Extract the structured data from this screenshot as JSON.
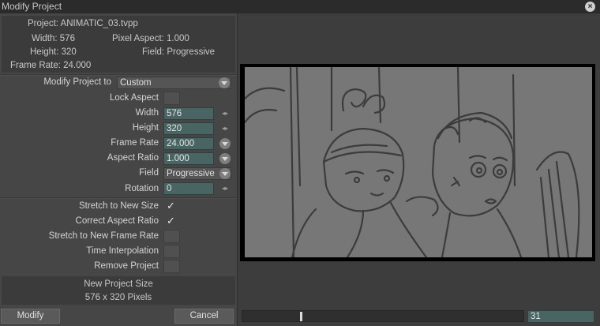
{
  "window": {
    "title": "Modify Project"
  },
  "project": {
    "name": "Project: ANIMATIC_03.tvpp",
    "width": "Width: 576",
    "pixel_aspect": "Pixel Aspect: 1.000",
    "height": "Height: 320",
    "field": "Field: Progressive",
    "frame_rate": "Frame Rate: 24.000"
  },
  "form": {
    "modify_to": {
      "label": "Modify Project to",
      "value": "Custom"
    },
    "lock_aspect": {
      "label": "Lock Aspect"
    },
    "width": {
      "label": "Width",
      "value": "576"
    },
    "height": {
      "label": "Height",
      "value": "320"
    },
    "frame_rate": {
      "label": "Frame Rate",
      "value": "24.000"
    },
    "aspect_ratio": {
      "label": "Aspect Ratio",
      "value": "1.000"
    },
    "field": {
      "label": "Field",
      "value": "Progressive"
    },
    "rotation": {
      "label": "Rotation",
      "value": "0"
    }
  },
  "options": {
    "stretch_size": {
      "label": "Stretch to New Size",
      "checked": true
    },
    "correct_aspect": {
      "label": "Correct Aspect Ratio",
      "checked": true
    },
    "stretch_rate": {
      "label": "Stretch to New Frame Rate",
      "checked": false
    },
    "time_interp": {
      "label": "Time Interpolation",
      "checked": false
    },
    "remove_project": {
      "label": "Remove Project",
      "checked": false
    },
    "check_glyph": "✓"
  },
  "summary": {
    "line1": "New Project Size",
    "line2": "576 x 320 Pixels"
  },
  "buttons": {
    "modify": "Modify",
    "cancel": "Cancel"
  },
  "timeline": {
    "frame": "31"
  },
  "icons": {
    "close": "×",
    "spin": "◂▸"
  }
}
